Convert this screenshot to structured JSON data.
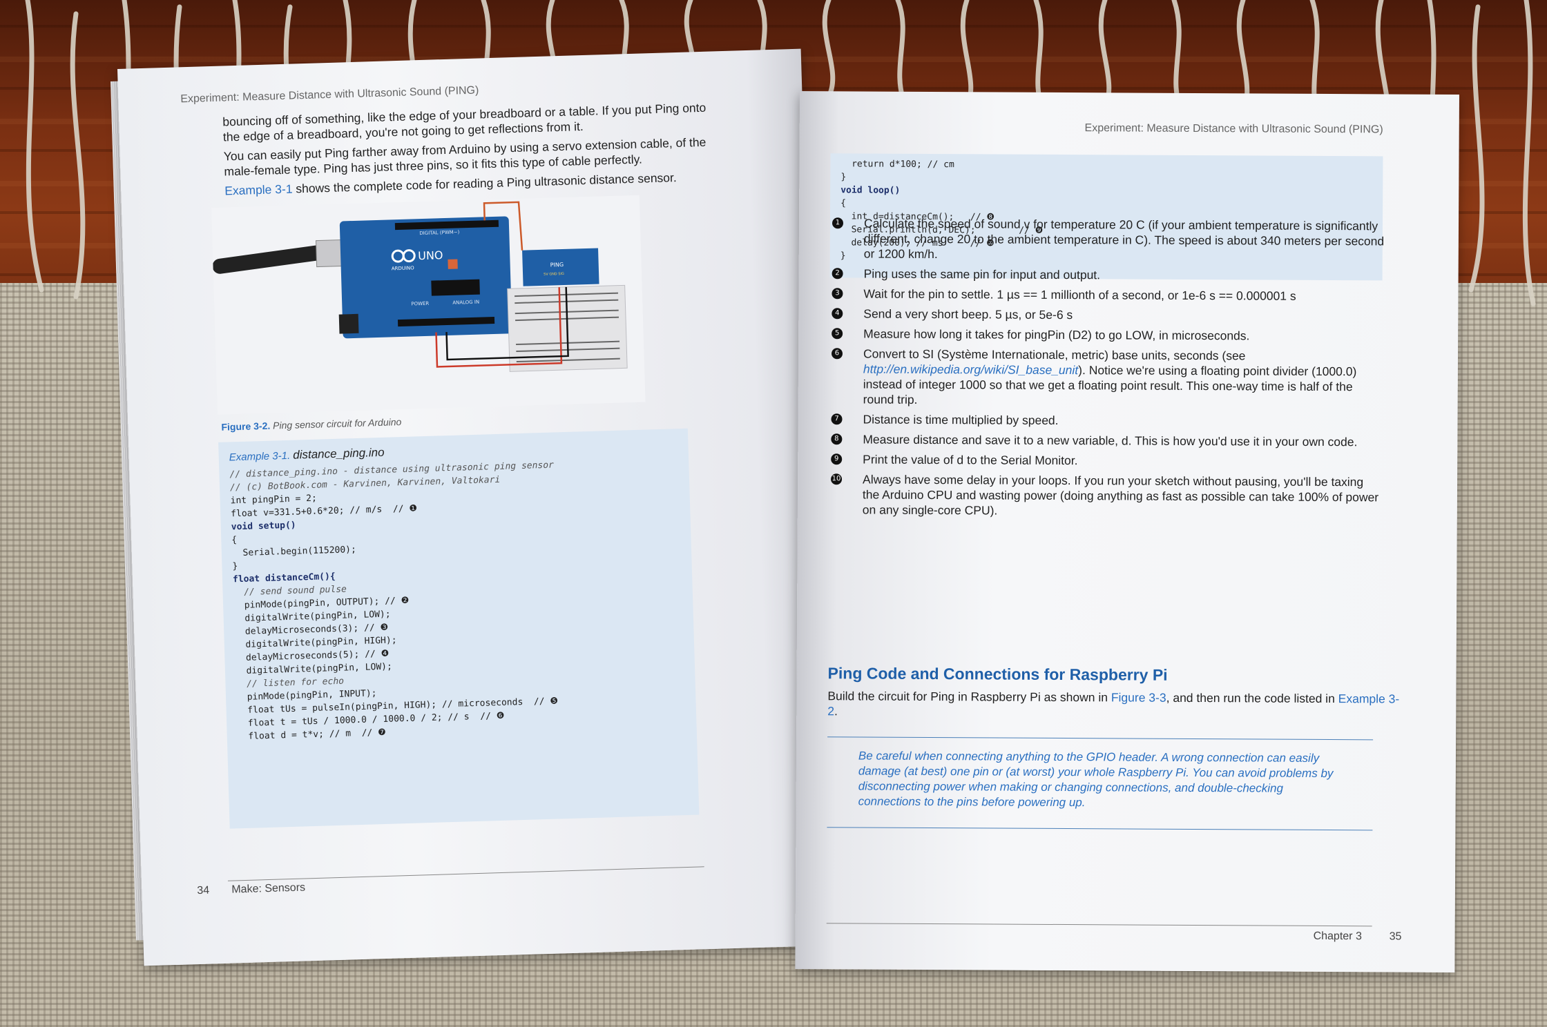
{
  "left_page": {
    "running_head": "Experiment: Measure Distance with Ultrasonic Sound (PING)",
    "paragraphs": [
      "bouncing off of something, like the edge of your breadboard or a table. If you put Ping onto the edge of a breadboard, you're not going to get reflections from it.",
      "You can easily put Ping farther away from Arduino by using a servo extension cable, of the male-female type. Ping has just three pins, so it fits this type of cable perfectly."
    ],
    "example_ref_link": "Example 3-1",
    "example_ref_rest": " shows the complete code for reading a Ping ultrasonic distance sensor.",
    "figure": {
      "board_label": "UNO",
      "board_brand": "ARDUINO",
      "digital_label": "DIGITAL (PWM~)",
      "power_label": "POWER",
      "analog_label": "ANALOG IN",
      "sensor_label": "PING",
      "sensor_pins": "5V GND SIG",
      "caption_label": "Figure 3-2.",
      "caption_text": "Ping sensor circuit for Arduino"
    },
    "code": {
      "title_label": "Example 3-1.",
      "title_file": "distance_ping.ino",
      "lines": [
        "// distance_ping.ino - distance using ultrasonic ping sensor",
        "// (c) BotBook.com - Karvinen, Karvinen, Valtokari",
        "",
        "int pingPin = 2;",
        "float v=331.5+0.6*20; // m/s  // ❶",
        "",
        "void setup()",
        "{",
        "  Serial.begin(115200);",
        "}",
        "",
        "float distanceCm(){",
        "  // send sound pulse",
        "  pinMode(pingPin, OUTPUT); // ❷",
        "  digitalWrite(pingPin, LOW);",
        "  delayMicroseconds(3); // ❸",
        "  digitalWrite(pingPin, HIGH);",
        "  delayMicroseconds(5); // ❹",
        "  digitalWrite(pingPin, LOW);",
        "",
        "  // listen for echo",
        "  pinMode(pingPin, INPUT);",
        "  float tUs = pulseIn(pingPin, HIGH); // microseconds  // ❺",
        "  float t = tUs / 1000.0 / 1000.0 / 2; // s  // ❻",
        "  float d = t*v; // m  // ❼"
      ]
    },
    "footer_page_number": "34",
    "footer_book": "Make: Sensors"
  },
  "right_page": {
    "running_head": "Experiment: Measure Distance with Ultrasonic Sound (PING)",
    "code_lines": [
      "  return d*100; // cm",
      "}",
      "",
      "void loop()",
      "{",
      "  int d=distanceCm();   // ❽",
      "  Serial.println(d, DEC);        // ❾",
      "  delay(200); // ms     // ❿",
      "}"
    ],
    "callouts": [
      {
        "n": "1",
        "text": "Calculate the speed of sound v for temperature 20 C (if your ambient temperature is significantly different, change 20 to the ambient temperature in C). The speed is about 340 meters per second or 1200 km/h."
      },
      {
        "n": "2",
        "text": "Ping uses the same pin for input and output."
      },
      {
        "n": "3",
        "text": "Wait for the pin to settle. 1 µs == 1 millionth of a second, or 1e-6 s == 0.000001 s"
      },
      {
        "n": "4",
        "text": "Send a very short beep. 5 µs, or 5e-6 s"
      },
      {
        "n": "5",
        "text": "Measure how long it takes for pingPin (D2) to go LOW, in microseconds."
      },
      {
        "n": "6",
        "text_before": "Convert to SI (Système Internationale, metric) base units, seconds (see ",
        "link": "http://en.wikipedia.org/wiki/SI_base_unit",
        "text_after": "). Notice we're using a floating point divider (1000.0) instead of integer 1000 so that we get a floating point result. This one-way time is half of the round trip."
      },
      {
        "n": "7",
        "text": "Distance is time multiplied by speed."
      },
      {
        "n": "8",
        "text": "Measure distance and save it to a new variable, d. This is how you'd use it in your own code."
      },
      {
        "n": "9",
        "text": "Print the value of d to the Serial Monitor."
      },
      {
        "n": "10",
        "text": "Always have some delay in your loops. If you run your sketch without pausing, you'll be taxing the Arduino CPU and wasting power (doing anything as fast as possible can take 100% of power on any single-core CPU)."
      }
    ],
    "section_heading": "Ping Code and Connections for Raspberry Pi",
    "section_text_1": "Build the circuit for Ping in Raspberry Pi as shown in ",
    "section_link_1": "Figure 3-3",
    "section_text_2": ", and then run the code listed in ",
    "section_link_2": "Example 3-2",
    "section_text_3": ".",
    "note": "Be careful when connecting anything to the GPIO header. A wrong connection can easily damage (at best) one pin or (at worst) your whole Raspberry Pi. You can avoid problems by disconnecting power when making or changing connections, and double-checking connections to the pins before powering up.",
    "footer_chapter": "Chapter 3",
    "footer_page_number": "35"
  },
  "colors": {
    "link_blue": "#2a6fc0",
    "heading_blue": "#1f5fa8",
    "code_background": "#dbe7f3",
    "arduino_blue": "#1f5fa6",
    "wood": "#7a2f12",
    "rug": "#c4bcaa"
  }
}
